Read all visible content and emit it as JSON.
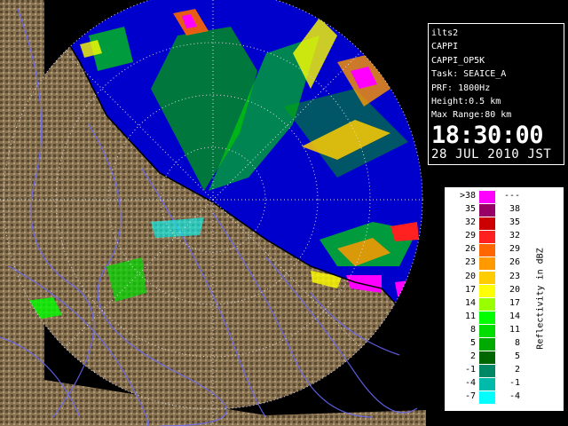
{
  "info": {
    "site": "ilts2",
    "product": "CAPPI",
    "product_name": "CAPPI_OP5K",
    "task": "Task: SEAICE_A",
    "prf": "PRF: 1800Hz",
    "height": "Height:0.5 km",
    "max_range": "Max Range:80 km",
    "time": "18:30:00",
    "date": "28 JUL 2010 JST"
  },
  "legend": {
    "title": "Reflectivity in dBZ",
    "rows": [
      {
        "lo": ">38",
        "hi": "---",
        "color": "#ff00ff"
      },
      {
        "lo": "35",
        "hi": "38",
        "color": "#990066"
      },
      {
        "lo": "32",
        "hi": "35",
        "color": "#cc0000"
      },
      {
        "lo": "29",
        "hi": "32",
        "color": "#ff2020"
      },
      {
        "lo": "26",
        "hi": "29",
        "color": "#ff6600"
      },
      {
        "lo": "23",
        "hi": "26",
        "color": "#ff9900"
      },
      {
        "lo": "20",
        "hi": "23",
        "color": "#ffcc00"
      },
      {
        "lo": "17",
        "hi": "20",
        "color": "#ffff00"
      },
      {
        "lo": "14",
        "hi": "17",
        "color": "#99ff00"
      },
      {
        "lo": "11",
        "hi": "14",
        "color": "#00ff00"
      },
      {
        "lo": "8",
        "hi": "11",
        "color": "#00dd00"
      },
      {
        "lo": "5",
        "hi": "8",
        "color": "#00aa00"
      },
      {
        "lo": "2",
        "hi": "5",
        "color": "#006600"
      },
      {
        "lo": "-1",
        "hi": "2",
        "color": "#008866"
      },
      {
        "lo": "-4",
        "hi": "-1",
        "color": "#00bbaa"
      },
      {
        "lo": "-7",
        "hi": "-4",
        "color": "#00ffff"
      }
    ]
  },
  "colors": {
    "sea": "#0000cc",
    "land": "#8a7350",
    "range_ring": "#cccccc",
    "background": "#000000"
  }
}
